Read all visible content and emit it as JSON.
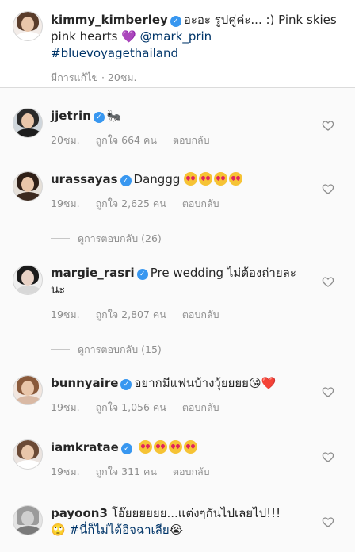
{
  "caption": {
    "username": "kimmy_kimberley",
    "text": "อะอะ รูปคู่ค่ะ... :) Pink skies",
    "text2": "pink hearts 💜 ",
    "mention": "@mark_prin",
    "hashtag": "#bluevoyagethailand",
    "meta": "มีการแก้ไข · 20ชม."
  },
  "comments": [
    {
      "username": "jjetrin",
      "text": "🐜",
      "time": "20ชม.",
      "likes": "ถูกใจ 664 คน",
      "reply": "ตอบกลับ"
    },
    {
      "username": "urassayas",
      "text": "Danggg",
      "emoji_count": 4,
      "time": "19ชม.",
      "likes": "ถูกใจ 2,625 คน",
      "reply": "ตอบกลับ",
      "view_replies": "ดูการตอบกลับ (26)"
    },
    {
      "username": "margie_rasri",
      "text": "Pre wedding ไม่ต้องถ่ายละ",
      "text2": "นะ",
      "time": "19ชม.",
      "likes": "ถูกใจ 2,807 คน",
      "reply": "ตอบกลับ",
      "view_replies": "ดูการตอบกลับ (15)"
    },
    {
      "username": "bunnyaire",
      "text": "อยากมีแฟนบ้างวุ้ยยยย😘❤️",
      "time": "19ชม.",
      "likes": "ถูกใจ 1,056 คน",
      "reply": "ตอบกลับ"
    },
    {
      "username": "iamkratae",
      "text": "",
      "emoji_count": 4,
      "time": "19ชม.",
      "likes": "ถูกใจ 311 คน",
      "reply": "ตอบกลับ"
    },
    {
      "username": "payoon3",
      "text": "โอ๊ยยยยยย...แต่งๆกันไปเลยไป!!!",
      "text2_prefix": "🙄 ",
      "text2_tag": "#นี่ก็ไม่ได้อิจฉาเลีย",
      "text2_suffix": "😭"
    }
  ]
}
